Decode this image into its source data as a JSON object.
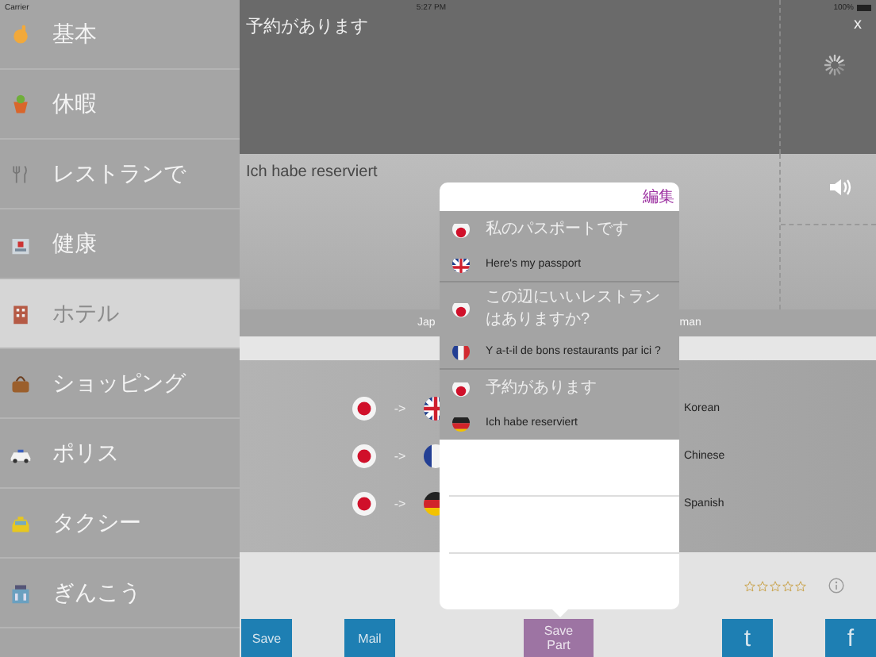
{
  "status_bar": {
    "carrier": "Carrier",
    "time": "5:27 PM",
    "battery": "100%"
  },
  "sidebar": {
    "items": [
      {
        "label": "基本",
        "selected": false
      },
      {
        "label": "休暇",
        "selected": false
      },
      {
        "label": "レストランで",
        "selected": false
      },
      {
        "label": "健康",
        "selected": false
      },
      {
        "label": "ホテル",
        "selected": true
      },
      {
        "label": "ショッピング",
        "selected": false
      },
      {
        "label": "ポリス",
        "selected": false
      },
      {
        "label": "タクシー",
        "selected": false
      },
      {
        "label": "ぎんこう",
        "selected": false
      }
    ]
  },
  "source_panel": {
    "text": "予約があります",
    "close": "x"
  },
  "target_panel": {
    "text": "Ich habe reserviert"
  },
  "language_bar": {
    "left": "Jap",
    "right": "man"
  },
  "pairs": [
    {
      "arrow": "->",
      "label": "Korean"
    },
    {
      "arrow": "->",
      "label": "Chinese"
    },
    {
      "arrow": "->",
      "label": "Spanish"
    }
  ],
  "popover": {
    "edit": "編集",
    "groups": [
      {
        "rows": [
          {
            "kind": "japan",
            "text": "私のパスポートです"
          },
          {
            "kind": "uk",
            "text": "Here's my passport"
          }
        ]
      },
      {
        "rows": [
          {
            "kind": "japan",
            "text": "この辺にいいレストランはありますか?"
          },
          {
            "kind": "france",
            "text": "Y a-t-il de bons restaurants par ici ?"
          }
        ]
      },
      {
        "rows": [
          {
            "kind": "japan",
            "text": "予約があります"
          },
          {
            "kind": "germany",
            "text": "Ich habe reserviert"
          }
        ]
      }
    ]
  },
  "rating": {
    "stars": 0
  },
  "buttons": [
    {
      "label": "Save",
      "selected": false
    },
    {
      "label": "Mail",
      "selected": false
    },
    {
      "label": "Save Part",
      "selected": true
    },
    {
      "label": "t",
      "selected": false
    },
    {
      "label": "f",
      "selected": false
    }
  ]
}
